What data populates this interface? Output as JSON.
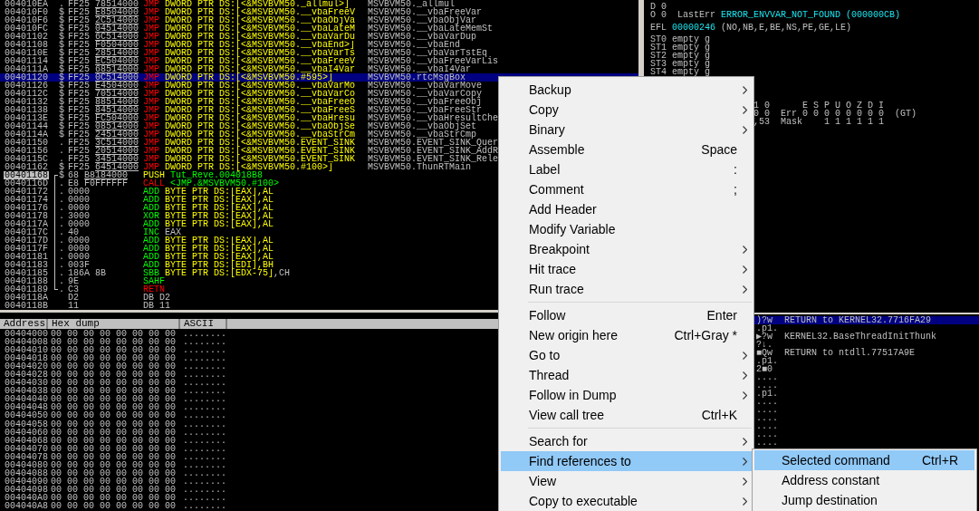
{
  "disassembly": {
    "rows": [
      {
        "address": "004010EA",
        "marker": ".",
        "hex": "FF25",
        "fixup": "78514000",
        "command": [
          {
            "text": "JMP",
            "kind": "branch"
          },
          {
            "text": "DWORD PTR DS:[<&MSVBVM50._allmul>]",
            "kind": "memory"
          }
        ],
        "comment": "MSVBVM50._allmul",
        "selected": false,
        "current": false
      },
      {
        "address": "004010F0",
        "marker": "$",
        "hex": "FF25",
        "fixup": "E8504000",
        "command": [
          {
            "text": "JMP",
            "kind": "branch"
          },
          {
            "text": "DWORD PTR DS:[<&MSVBVM50.__vbaFreeV",
            "kind": "memory"
          }
        ],
        "comment": "MSVBVM50.__vbaFreeVar",
        "selected": false,
        "current": false
      },
      {
        "address": "004010F6",
        "marker": "$",
        "hex": "FF25",
        "fixup": "2C514000",
        "command": [
          {
            "text": "JMP",
            "kind": "branch"
          },
          {
            "text": "DWORD PTR DS:[<&MSVBVM50.__vbaObjVa",
            "kind": "memory"
          }
        ],
        "comment": "MSVBVM50.__vbaObjVar",
        "selected": false,
        "current": false
      },
      {
        "address": "004010FC",
        "marker": "$",
        "hex": "FF25",
        "fixup": "04514000",
        "command": [
          {
            "text": "JMP",
            "kind": "branch"
          },
          {
            "text": "DWORD PTR DS:[<&MSVBVM50.__vbaLateM",
            "kind": "memory"
          }
        ],
        "comment": "MSVBVM50.__vbaLateMemSt",
        "selected": false,
        "current": false
      },
      {
        "address": "00401102",
        "marker": "$",
        "hex": "FF25",
        "fixup": "6C514000",
        "command": [
          {
            "text": "JMP",
            "kind": "branch"
          },
          {
            "text": "DWORD PTR DS:[<&MSVBVM50.__vbaVarDu",
            "kind": "memory"
          }
        ],
        "comment": "MSVBVM50.__vbaVarDup",
        "selected": false,
        "current": false
      },
      {
        "address": "00401108",
        "marker": "$",
        "hex": "FF25",
        "fixup": "F0504000",
        "command": [
          {
            "text": "JMP",
            "kind": "branch"
          },
          {
            "text": "DWORD PTR DS:[<&MSVBVM50.__vbaEnd>]",
            "kind": "memory"
          }
        ],
        "comment": "MSVBVM50.__vbaEnd",
        "selected": false,
        "current": false
      },
      {
        "address": "0040110E",
        "marker": "$",
        "hex": "FF25",
        "fixup": "28514000",
        "command": [
          {
            "text": "JMP",
            "kind": "branch"
          },
          {
            "text": "DWORD PTR DS:[<&MSVBVM50.__vbaVarTs",
            "kind": "memory"
          }
        ],
        "comment": "MSVBVM50.__vbaVarTstEq",
        "selected": false,
        "current": false
      },
      {
        "address": "00401114",
        "marker": "$",
        "hex": "FF25",
        "fixup": "EC504000",
        "command": [
          {
            "text": "JMP",
            "kind": "branch"
          },
          {
            "text": "DWORD PTR DS:[<&MSVBVM50.__vbaFreeV",
            "kind": "memory"
          }
        ],
        "comment": "MSVBVM50.__vbaFreeVarLis",
        "selected": false,
        "current": false
      },
      {
        "address": "0040111A",
        "marker": "$",
        "hex": "FF25",
        "fixup": "68514000",
        "command": [
          {
            "text": "JMP",
            "kind": "branch"
          },
          {
            "text": "DWORD PTR DS:[<&MSVBVM50.__vbaI4Var",
            "kind": "memory"
          }
        ],
        "comment": "MSVBVM50.__vbaI4Var",
        "selected": false,
        "current": false
      },
      {
        "address": "00401120",
        "marker": "$",
        "hex": "FF25",
        "fixup": "0C514000",
        "command": [
          {
            "text": "JMP",
            "kind": "branch"
          },
          {
            "text": "DWORD PTR DS:[<&MSVBVM50.#595>]",
            "kind": "memory"
          }
        ],
        "comment": "MSVBVM50.rtcMsgBox",
        "selected": true,
        "current": false
      },
      {
        "address": "00401126",
        "marker": "$",
        "hex": "FF25",
        "fixup": "E4504000",
        "command": [
          {
            "text": "JMP",
            "kind": "branch"
          },
          {
            "text": "DWORD PTR DS:[<&MSVBVM50.__vbaVarMo",
            "kind": "memory"
          }
        ],
        "comment": "MSVBVM50.__vbaVarMove",
        "selected": false,
        "current": false
      },
      {
        "address": "0040112C",
        "marker": "$",
        "hex": "FF25",
        "fixup": "70514000",
        "command": [
          {
            "text": "JMP",
            "kind": "branch"
          },
          {
            "text": "DWORD PTR DS:[<&MSVBVM50.__vbaVarCo",
            "kind": "memory"
          }
        ],
        "comment": "MSVBVM50.__vbaVarCopy",
        "selected": false,
        "current": false
      },
      {
        "address": "00401132",
        "marker": "$",
        "hex": "FF25",
        "fixup": "88514000",
        "command": [
          {
            "text": "JMP",
            "kind": "branch"
          },
          {
            "text": "DWORD PTR DS:[<&MSVBVM50.__vbaFreeO",
            "kind": "memory"
          }
        ],
        "comment": "MSVBVM50.__vbaFreeObj",
        "selected": false,
        "current": false
      },
      {
        "address": "00401138",
        "marker": "$",
        "hex": "FF25",
        "fixup": "84514000",
        "command": [
          {
            "text": "JMP",
            "kind": "branch"
          },
          {
            "text": "DWORD PTR DS:[<&MSVBVM50.__vbaFreeS",
            "kind": "memory"
          }
        ],
        "comment": "MSVBVM50.__vbaFreeStr",
        "selected": false,
        "current": false
      },
      {
        "address": "0040113E",
        "marker": "$",
        "hex": "FF25",
        "fixup": "FC504000",
        "command": [
          {
            "text": "JMP",
            "kind": "branch"
          },
          {
            "text": "DWORD PTR DS:[<&MSVBVM50.__vbaHresu",
            "kind": "memory"
          }
        ],
        "comment": "MSVBVM50.__vbaHresultChe",
        "selected": false,
        "current": false
      },
      {
        "address": "00401144",
        "marker": "$",
        "hex": "FF25",
        "fixup": "08514000",
        "command": [
          {
            "text": "JMP",
            "kind": "branch"
          },
          {
            "text": "DWORD PTR DS:[<&MSVBVM50.__vbaObjSe",
            "kind": "memory"
          }
        ],
        "comment": "MSVBVM50.__vbaObjSet",
        "selected": false,
        "current": false
      },
      {
        "address": "0040114A",
        "marker": "$",
        "hex": "FF25",
        "fixup": "24514000",
        "command": [
          {
            "text": "JMP",
            "kind": "branch"
          },
          {
            "text": "DWORD PTR DS:[<&MSVBVM50.__vbaStrCm",
            "kind": "memory"
          }
        ],
        "comment": "MSVBVM50.__vbaStrCmp",
        "selected": false,
        "current": false
      },
      {
        "address": "00401150",
        "marker": ".",
        "hex": "FF25",
        "fixup": "3C514000",
        "command": [
          {
            "text": "JMP",
            "kind": "branch"
          },
          {
            "text": "DWORD PTR DS:[<&MSVBVM50.EVENT_SINK",
            "kind": "memory"
          }
        ],
        "comment": "MSVBVM50.EVENT_SINK_Quer",
        "selected": false,
        "current": false
      },
      {
        "address": "00401156",
        "marker": ".",
        "hex": "FF25",
        "fixup": "20514000",
        "command": [
          {
            "text": "JMP",
            "kind": "branch"
          },
          {
            "text": "DWORD PTR DS:[<&MSVBVM50.EVENT_SINK",
            "kind": "memory"
          }
        ],
        "comment": "MSVBVM50.EVENT_SINK_AddR",
        "selected": false,
        "current": false
      },
      {
        "address": "0040115C",
        "marker": ".",
        "hex": "FF25",
        "fixup": "34514000",
        "command": [
          {
            "text": "JMP",
            "kind": "branch"
          },
          {
            "text": "DWORD PTR DS:[<&MSVBVM50.EVENT_SINK",
            "kind": "memory"
          }
        ],
        "comment": "MSVBVM50.EVENT_SINK_Rele",
        "selected": false,
        "current": false
      },
      {
        "address": "00401162",
        "marker": "$",
        "hex": "FF25",
        "fixup": "64514000",
        "command": [
          {
            "text": "JMP",
            "kind": "branch"
          },
          {
            "text": "DWORD PTR DS:[<&MSVBVM50.#100>]",
            "kind": "memory"
          }
        ],
        "comment": "MSVBVM50.ThunRTMain",
        "selected": false,
        "current": false
      },
      {
        "address": "00401168",
        "marker": "$",
        "bracket": {
          "kind": "start"
        },
        "hex": "68",
        "fixup": "B8184000",
        "command": [
          {
            "text": "PUSH",
            "kind": "stack"
          },
          {
            "text": "Tut_Reve.004018B8",
            "kind": "symbol"
          }
        ],
        "selected": false,
        "current": true
      },
      {
        "address": "0040116D",
        "marker": ".",
        "bracket": {
          "kind": "mid"
        },
        "hex": "E8 F0FFFFFF",
        "command": [
          {
            "text": "CALL",
            "kind": "branch"
          },
          {
            "text": "<JMP.&MSVBVM50.#100>",
            "kind": "symbol"
          }
        ],
        "selected": false,
        "current": false
      },
      {
        "address": "00401172",
        "marker": ".",
        "bracket": {
          "kind": "mid"
        },
        "hex": "0000",
        "command": [
          {
            "text": "ADD",
            "kind": "op"
          },
          {
            "text": "BYTE PTR DS:[EAX],AL",
            "kind": "memory"
          }
        ],
        "selected": false,
        "current": false
      },
      {
        "address": "00401174",
        "marker": ".",
        "bracket": {
          "kind": "mid"
        },
        "hex": "0000",
        "command": [
          {
            "text": "ADD",
            "kind": "op"
          },
          {
            "text": "BYTE PTR DS:[EAX],AL",
            "kind": "memory"
          }
        ],
        "selected": false,
        "current": false
      },
      {
        "address": "00401176",
        "marker": ".",
        "bracket": {
          "kind": "mid"
        },
        "hex": "0000",
        "command": [
          {
            "text": "ADD",
            "kind": "op"
          },
          {
            "text": "BYTE PTR DS:[EAX],AL",
            "kind": "memory"
          }
        ],
        "selected": false,
        "current": false
      },
      {
        "address": "00401178",
        "marker": ".",
        "bracket": {
          "kind": "mid"
        },
        "hex": "3000",
        "command": [
          {
            "text": "XOR",
            "kind": "op"
          },
          {
            "text": "BYTE PTR DS:[EAX],AL",
            "kind": "memory"
          }
        ],
        "selected": false,
        "current": false
      },
      {
        "address": "0040117A",
        "marker": ".",
        "bracket": {
          "kind": "mid"
        },
        "hex": "0000",
        "command": [
          {
            "text": "ADD",
            "kind": "op"
          },
          {
            "text": "BYTE PTR DS:[EAX],AL",
            "kind": "memory"
          }
        ],
        "selected": false,
        "current": false
      },
      {
        "address": "0040117C",
        "marker": ".",
        "bracket": {
          "kind": "mid"
        },
        "hex": "40",
        "command": [
          {
            "text": "INC",
            "kind": "op"
          },
          {
            "text": "EAX",
            "kind": "register"
          }
        ],
        "selected": false,
        "current": false
      },
      {
        "address": "0040117D",
        "marker": ".",
        "bracket": {
          "kind": "mid"
        },
        "hex": "0000",
        "command": [
          {
            "text": "ADD",
            "kind": "op"
          },
          {
            "text": "BYTE PTR DS:[EAX],AL",
            "kind": "memory"
          }
        ],
        "selected": false,
        "current": false
      },
      {
        "address": "0040117F",
        "marker": ".",
        "bracket": {
          "kind": "mid"
        },
        "hex": "0000",
        "command": [
          {
            "text": "ADD",
            "kind": "op"
          },
          {
            "text": "BYTE PTR DS:[EAX],AL",
            "kind": "memory"
          }
        ],
        "selected": false,
        "current": false
      },
      {
        "address": "00401181",
        "marker": ".",
        "bracket": {
          "kind": "mid"
        },
        "hex": "0000",
        "command": [
          {
            "text": "ADD",
            "kind": "op"
          },
          {
            "text": "BYTE PTR DS:[EAX],AL",
            "kind": "memory"
          }
        ],
        "selected": false,
        "current": false
      },
      {
        "address": "00401183",
        "marker": ".",
        "bracket": {
          "kind": "mid"
        },
        "hex": "003F",
        "command": [
          {
            "text": "ADD",
            "kind": "op"
          },
          {
            "text": "BYTE PTR DS:[EDI],BH",
            "kind": "memory"
          }
        ],
        "selected": false,
        "current": false
      },
      {
        "address": "00401185",
        "marker": ".",
        "bracket": {
          "kind": "mid"
        },
        "hex": "186A 8B",
        "command": [
          {
            "text": "SBB",
            "kind": "op"
          },
          {
            "text": "BYTE PTR DS:[EDX-75]",
            "kind": "memory"
          },
          {
            "text": ",CH",
            "kind": "register"
          }
        ],
        "selected": false,
        "current": false
      },
      {
        "address": "00401188",
        "marker": ".",
        "bracket": {
          "kind": "mid"
        },
        "hex": "9E",
        "command": [
          {
            "text": "SAHF",
            "kind": "op"
          }
        ],
        "selected": false,
        "current": false
      },
      {
        "address": "00401189",
        "marker": ".",
        "bracket": {
          "kind": "end"
        },
        "hex": "C3",
        "command": [
          {
            "text": "RETN",
            "kind": "branch"
          }
        ],
        "selected": false,
        "current": false
      },
      {
        "address": "0040118A",
        "hex": "D2",
        "command": [
          {
            "text": "DB D2",
            "kind": "data"
          }
        ],
        "selected": false,
        "current": false
      },
      {
        "address": "0040118B",
        "hex": "11",
        "command": [
          {
            "text": "DB 11",
            "kind": "data"
          }
        ],
        "selected": false,
        "current": false
      }
    ]
  },
  "registers": {
    "groups": [
      [
        [
          {
            "text": "D 0",
            "kind": "plain"
          }
        ],
        [
          {
            "text": "O 0  LastErr",
            "kind": "plain"
          },
          {
            "text": "ERROR_ENVVAR_NOT_FOUND (000000CB)",
            "kind": "changed"
          }
        ]
      ],
      [
        [
          {
            "text": "EFL",
            "kind": "plain"
          },
          {
            "text": "00000246",
            "kind": "changed"
          },
          {
            "text": "(NO,NB,E,BE,NS,PE,GE,LE)",
            "kind": "plain"
          }
        ]
      ],
      [
        [
          {
            "text": "ST0 empty g",
            "kind": "plain"
          }
        ],
        [
          {
            "text": "ST1 empty g",
            "kind": "plain"
          }
        ],
        [
          {
            "text": "ST2 empty g",
            "kind": "plain"
          }
        ],
        [
          {
            "text": "ST3 empty g",
            "kind": "plain"
          }
        ],
        [
          {
            "text": "ST4 empty g",
            "kind": "plain"
          }
        ]
      ],
      [
        [
          {
            "text": "1 0      E S P U O Z D I",
            "kind": "plain"
          }
        ],
        [
          {
            "text": "0 0  Err 0 0 0 0 0 0 0 0  (GT)",
            "kind": "plain"
          }
        ],
        [
          {
            "text": ",53  Mask    1 1 1 1 1 1",
            "kind": "plain"
          }
        ]
      ]
    ]
  },
  "dump": {
    "columns": [
      "Address",
      "Hex dump",
      "ASCII"
    ],
    "rows": [
      {
        "address": "00404000",
        "hex": "00 00 00 00 00 00 00 00",
        "ascii": "........"
      },
      {
        "address": "00404008",
        "hex": "00 00 00 00 00 00 00 00",
        "ascii": "........"
      },
      {
        "address": "00404010",
        "hex": "00 00 00 00 00 00 00 00",
        "ascii": "........"
      },
      {
        "address": "00404018",
        "hex": "00 00 00 00 00 00 00 00",
        "ascii": "........"
      },
      {
        "address": "00404020",
        "hex": "00 00 00 00 00 00 00 00",
        "ascii": "........"
      },
      {
        "address": "00404028",
        "hex": "00 00 00 00 00 00 00 00",
        "ascii": "........"
      },
      {
        "address": "00404030",
        "hex": "00 00 00 00 00 00 00 00",
        "ascii": "........"
      },
      {
        "address": "00404038",
        "hex": "00 00 00 00 00 00 00 00",
        "ascii": "........"
      },
      {
        "address": "00404040",
        "hex": "00 00 00 00 00 00 00 00",
        "ascii": "........"
      },
      {
        "address": "00404048",
        "hex": "00 00 00 00 00 00 00 00",
        "ascii": "........"
      },
      {
        "address": "00404050",
        "hex": "00 00 00 00 00 00 00 00",
        "ascii": "........"
      },
      {
        "address": "00404058",
        "hex": "00 00 00 00 00 00 00 00",
        "ascii": "........"
      },
      {
        "address": "00404060",
        "hex": "00 00 00 00 00 00 00 00",
        "ascii": "........"
      },
      {
        "address": "00404068",
        "hex": "00 00 00 00 00 00 00 00",
        "ascii": "........"
      },
      {
        "address": "00404070",
        "hex": "00 00 00 00 00 00 00 00",
        "ascii": "........"
      },
      {
        "address": "00404078",
        "hex": "00 00 00 00 00 00 00 00",
        "ascii": "........"
      },
      {
        "address": "00404080",
        "hex": "00 00 00 00 00 00 00 00",
        "ascii": "........"
      },
      {
        "address": "00404088",
        "hex": "00 00 00 00 00 00 00 00",
        "ascii": "........"
      },
      {
        "address": "00404090",
        "hex": "00 00 00 00 00 00 00 00",
        "ascii": "........"
      },
      {
        "address": "00404098",
        "hex": "00 00 00 00 00 00 00 00",
        "ascii": "........"
      },
      {
        "address": "004040A0",
        "hex": "00 00 00 00 00 00 00 00",
        "ascii": "........"
      },
      {
        "address": "004040A8",
        "hex": "00 00 00 00 00 00 00 00",
        "ascii": "........"
      }
    ]
  },
  "stack": {
    "rows": [
      {
        "ascii": ")?w",
        "comment": "RETURN to KERNEL32.7716FA29",
        "selected": true
      },
      {
        "ascii": ".p1.",
        "selected": false
      },
      {
        "ascii": "▶?w",
        "comment": "KERNEL32.BaseThreadInitThunk",
        "selected": false
      },
      {
        "ascii": "?↓.",
        "selected": false
      },
      {
        "ascii": "■Qw",
        "comment": "RETURN to ntdll.77517A9E",
        "selected": false
      },
      {
        "ascii": ".p1.",
        "selected": false
      },
      {
        "ascii": "2■0",
        "selected": false
      },
      {
        "ascii": "....",
        "selected": false
      },
      {
        "ascii": "....",
        "selected": false
      },
      {
        "ascii": ".p1.",
        "selected": false
      },
      {
        "ascii": "....",
        "selected": false
      },
      {
        "ascii": "....",
        "selected": false
      },
      {
        "ascii": "....",
        "selected": false
      },
      {
        "ascii": "....",
        "selected": false
      },
      {
        "ascii": "....",
        "selected": false
      },
      {
        "ascii": "....",
        "selected": false
      }
    ]
  },
  "context_menu": {
    "items": [
      {
        "kind": "item",
        "label": "Backup",
        "submenu": true,
        "selected": false
      },
      {
        "kind": "item",
        "label": "Copy",
        "submenu": true,
        "selected": false
      },
      {
        "kind": "item",
        "label": "Binary",
        "submenu": true,
        "selected": false
      },
      {
        "kind": "item",
        "label": "Assemble",
        "shortcut": "Space",
        "submenu": false,
        "selected": false
      },
      {
        "kind": "item",
        "label": "Label",
        "shortcut": ":",
        "submenu": false,
        "selected": false
      },
      {
        "kind": "item",
        "label": "Comment",
        "shortcut": ";",
        "submenu": false,
        "selected": false
      },
      {
        "kind": "item",
        "label": "Add Header",
        "submenu": false,
        "selected": false
      },
      {
        "kind": "item",
        "label": "Modify Variable",
        "submenu": false,
        "selected": false
      },
      {
        "kind": "item",
        "label": "Breakpoint",
        "submenu": true,
        "selected": false
      },
      {
        "kind": "item",
        "label": "Hit trace",
        "submenu": true,
        "selected": false
      },
      {
        "kind": "item",
        "label": "Run trace",
        "submenu": true,
        "selected": false
      },
      {
        "kind": "separator"
      },
      {
        "kind": "item",
        "label": "Follow",
        "shortcut": "Enter",
        "submenu": false,
        "selected": false
      },
      {
        "kind": "item",
        "label": "New origin here",
        "shortcut": "Ctrl+Gray *",
        "submenu": false,
        "selected": false
      },
      {
        "kind": "item",
        "label": "Go to",
        "submenu": true,
        "selected": false
      },
      {
        "kind": "item",
        "label": "Thread",
        "submenu": true,
        "selected": false
      },
      {
        "kind": "item",
        "label": "Follow in Dump",
        "submenu": true,
        "selected": false
      },
      {
        "kind": "item",
        "label": "View call tree",
        "shortcut": "Ctrl+K",
        "submenu": false,
        "selected": false
      },
      {
        "kind": "separator"
      },
      {
        "kind": "item",
        "label": "Search for",
        "submenu": true,
        "selected": false
      },
      {
        "kind": "item",
        "label": "Find references to",
        "submenu": true,
        "selected": true
      },
      {
        "kind": "item",
        "label": "View",
        "submenu": true,
        "selected": false
      },
      {
        "kind": "item",
        "label": "Copy to executable",
        "submenu": true,
        "selected": false
      }
    ]
  },
  "submenu": {
    "items": [
      {
        "kind": "item",
        "label": "Selected command",
        "shortcut": "Ctrl+R",
        "submenu": false,
        "selected": true
      },
      {
        "kind": "item",
        "label": "Address constant",
        "submenu": false,
        "selected": false
      },
      {
        "kind": "item",
        "label": "Jump destination",
        "submenu": false,
        "selected": false
      }
    ]
  }
}
